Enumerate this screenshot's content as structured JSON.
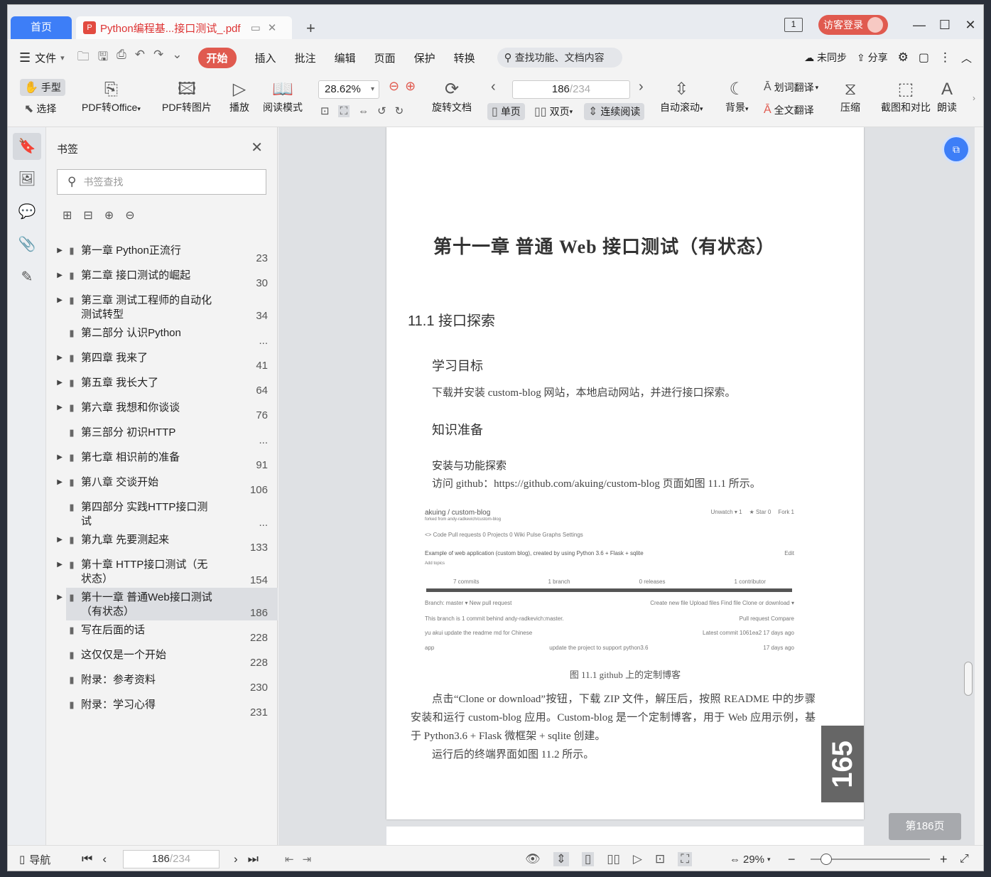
{
  "titlebar": {
    "home_tab": "首页",
    "doc_tab": "Python编程基...接口测试_.pdf",
    "page_indicator": "1",
    "login": "访客登录"
  },
  "menubar": {
    "file": "文件",
    "tabs": [
      "开始",
      "插入",
      "批注",
      "编辑",
      "页面",
      "保护",
      "转换"
    ],
    "search_placeholder": "查找功能、文档内容",
    "sync": "未同步",
    "share": "分享"
  },
  "ribbon": {
    "hand": "手型",
    "select": "选择",
    "pdf_to_office": "PDF转Office",
    "pdf_to_image": "PDF转图片",
    "play": "播放",
    "read_mode": "阅读模式",
    "zoom": "28.62%",
    "rotate": "旋转文档",
    "page_current": "186",
    "page_total": "/234",
    "single": "单页",
    "double": "双页",
    "continuous": "连续阅读",
    "auto_scroll": "自动滚动",
    "background": "背景",
    "word_translate": "划词翻译",
    "full_translate": "全文翻译",
    "compress": "压缩",
    "screenshot_compare": "截图和对比",
    "read_aloud": "朗读"
  },
  "bookmarks": {
    "title": "书签",
    "search_placeholder": "书签查找",
    "items": [
      {
        "text": "第一章 Python正流行",
        "page": "23",
        "arrow": true
      },
      {
        "text": "第二章 接口测试的崛起",
        "page": "30",
        "arrow": true
      },
      {
        "text": "第三章 测试工程师的自动化测试转型",
        "page": "34",
        "arrow": true
      },
      {
        "text": "第二部分 认识Python",
        "page": "...",
        "arrow": false
      },
      {
        "text": "第四章 我来了",
        "page": "41",
        "arrow": true
      },
      {
        "text": "第五章 我长大了",
        "page": "64",
        "arrow": true
      },
      {
        "text": "第六章 我想和你谈谈",
        "page": "76",
        "arrow": true
      },
      {
        "text": "第三部分 初识HTTP",
        "page": "...",
        "arrow": false
      },
      {
        "text": "第七章 相识前的准备",
        "page": "91",
        "arrow": true
      },
      {
        "text": "第八章 交谈开始",
        "page": "106",
        "arrow": true
      },
      {
        "text": "第四部分 实践HTTP接口测试",
        "page": "...",
        "arrow": false
      },
      {
        "text": "第九章 先要测起来",
        "page": "133",
        "arrow": true
      },
      {
        "text": "第十章 HTTP接口测试（无状态）",
        "page": "154",
        "arrow": true
      },
      {
        "text": "第十一章 普通Web接口测试（有状态）",
        "page": "186",
        "arrow": true,
        "selected": true
      },
      {
        "text": "写在后面的话",
        "page": "228",
        "arrow": false
      },
      {
        "text": "这仅仅是一个开始",
        "page": "228",
        "arrow": false
      },
      {
        "text": "附录：参考资料",
        "page": "230",
        "arrow": false
      },
      {
        "text": "附录：学习心得",
        "page": "231",
        "arrow": false
      }
    ]
  },
  "document": {
    "chapter_title": "第十一章  普通 Web 接口测试（有状态）",
    "section": "11.1  接口探索",
    "goal_heading": "学习目标",
    "goal_text": "下载并安装 custom-blog 网站，本地启动网站，并进行接口探索。",
    "knowledge_heading": "知识准备",
    "install_heading": "安装与功能探索",
    "install_text": "访问 github：https://github.com/akuing/custom-blog 页面如图 11.1 所示。",
    "figure": {
      "repo": "akuing / custom-blog",
      "forked": "forked from andy-radkevich/custom-blog",
      "unwatch": "Unwatch ▾   1",
      "star": "★ Star   0",
      "fork": "Fork   1",
      "tabs": "<> Code     Pull requests 0     Projects 0     Wiki     Pulse     Graphs     Settings",
      "desc": "Example of web application (custom blog), created by using Python 3.6 + Flask + sqlite",
      "edit": "Edit",
      "topics": "Add topics",
      "commits": "7 commits",
      "branch": "1 branch",
      "releases": "0 releases",
      "contributors": "1 contributor",
      "branch_sel": "Branch: master ▾     New pull request",
      "actions": "Create new file   Upload files   Find file   Clone or download ▾",
      "behind": "This branch is 1 commit behind andy-radkevich:master.",
      "pr_compare": "Pull request   Compare",
      "commit_msg": "yu akui update the readme md for Chinese",
      "latest": "Latest commit 1061ea2 17 days ago",
      "app": "app",
      "app_msg": "update the project to support python3.6",
      "app_time": "17 days ago"
    },
    "figure_caption": "图 11.1  github 上的定制博客",
    "body1": "点击“Clone or download”按钮，下载 ZIP 文件，解压后，按照 README 中的步骤安装和运行 custom-blog 应用。Custom-blog 是一个定制博客，用于 Web 应用示例，基于 Python3.6 + Flask 微框架 + sqlite 创建。",
    "body2": "运行后的终端界面如图 11.2 所示。",
    "page_number": "165",
    "page_badge": "第186页"
  },
  "statusbar": {
    "nav": "导航",
    "page_current": "186",
    "page_total": "/234",
    "zoom": "29%"
  },
  "colors": {
    "accent_blue": "#3d7ef7",
    "accent_red": "#e05a4f"
  }
}
